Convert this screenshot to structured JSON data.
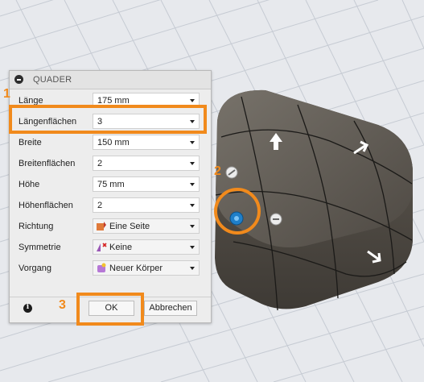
{
  "dialog": {
    "title": "QUADER",
    "fields": [
      {
        "label": "Länge",
        "value": "175 mm"
      },
      {
        "label": "Längenflächen",
        "value": "3"
      },
      {
        "label": "Breite",
        "value": "150 mm"
      },
      {
        "label": "Breitenflächen",
        "value": "2"
      },
      {
        "label": "Höhe",
        "value": "75 mm"
      },
      {
        "label": "Höhenflächen",
        "value": "2"
      },
      {
        "label": "Richtung",
        "value": "Eine Seite"
      },
      {
        "label": "Symmetrie",
        "value": "Keine"
      },
      {
        "label": "Vorgang",
        "value": "Neuer Körper"
      }
    ],
    "ok_label": "OK",
    "cancel_label": "Abbrechen"
  },
  "annotations": {
    "step1": "1",
    "step2": "2",
    "step3": "3"
  },
  "colors": {
    "highlight": "#f18a1c",
    "body": "#5a544b",
    "grid": "#c9ced6",
    "handle_blue": "#1f7fc9"
  },
  "icons": {
    "collapse": "collapse-icon",
    "info": "info-icon",
    "direction": "direction-one-side-icon",
    "symmetry": "symmetry-none-icon",
    "operation": "new-body-icon"
  }
}
